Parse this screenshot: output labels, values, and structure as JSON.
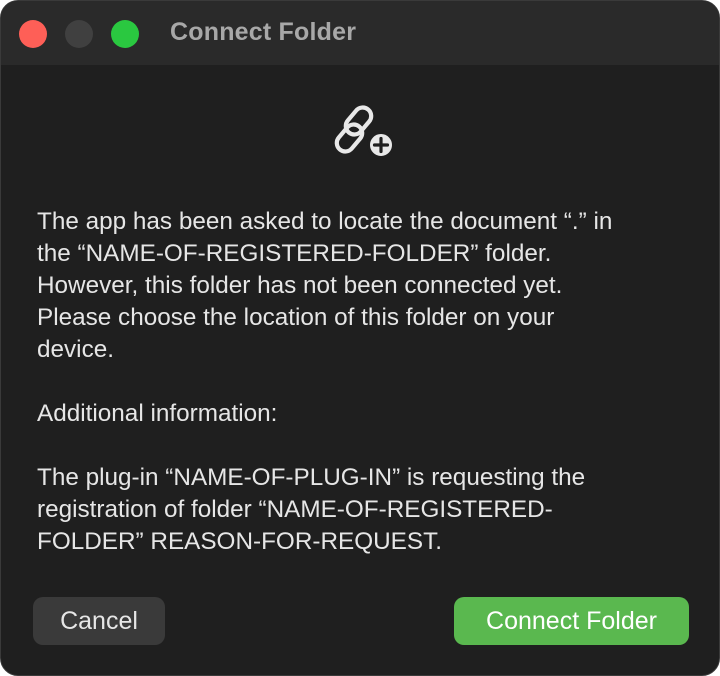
{
  "window": {
    "title": "Connect Folder",
    "traffic_lights": {
      "close_color": "#fe5f57",
      "minimize_color": "#404040",
      "zoom_color": "#2ac840"
    }
  },
  "dialog": {
    "icon": "link-plus-icon",
    "message_paragraphs": [
      "The app has been asked to locate the document “.” in\nthe “NAME-OF-REGISTERED-FOLDER” folder.\nHowever, this folder has not been connected yet.\nPlease choose the location of this folder on your\ndevice.",
      "Additional information:",
      "The plug-in “NAME-OF-PLUG-IN” is requesting the\nregistration of folder “NAME-OF-REGISTERED-\nFOLDER” REASON-FOR-REQUEST."
    ]
  },
  "buttons": {
    "cancel_label": "Cancel",
    "primary_label": "Connect Folder",
    "primary_color": "#5ab84f"
  }
}
